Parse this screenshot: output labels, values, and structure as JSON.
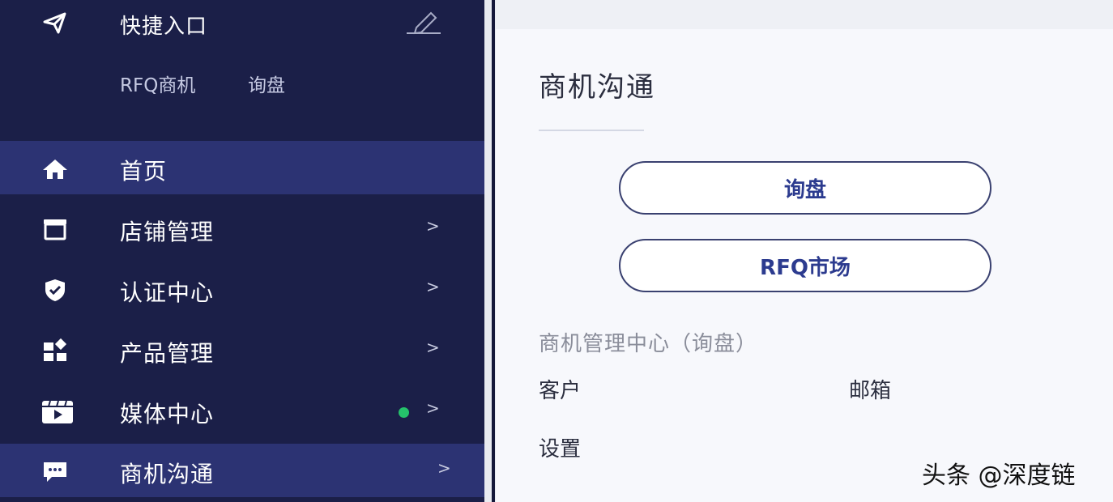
{
  "quick_access": {
    "title": "快捷入口",
    "links": [
      "RFQ商机",
      "询盘"
    ]
  },
  "nav": {
    "items": [
      {
        "label": "首页",
        "icon": "home-icon",
        "active": true
      },
      {
        "label": "店铺管理",
        "icon": "store-icon",
        "chevron": ">"
      },
      {
        "label": "认证中心",
        "icon": "shield-icon",
        "chevron": ">"
      },
      {
        "label": "产品管理",
        "icon": "grid-icon",
        "chevron": ">"
      },
      {
        "label": "媒体中心",
        "icon": "video-icon",
        "chevron": ">",
        "dot_color": "#25c26b"
      },
      {
        "label": "商机沟通",
        "icon": "message-icon",
        "chevron": ">",
        "active": true
      }
    ]
  },
  "panel": {
    "title": "商机沟通",
    "buttons": [
      "询盘",
      "RFQ市场"
    ],
    "section_title": "商机管理中心（询盘）",
    "links": {
      "customer": "客户",
      "mailbox": "邮箱",
      "settings": "设置"
    }
  },
  "watermark": "头条 @深度链",
  "colors": {
    "sidebar_bg": "#1b1f48",
    "active_bg": "#2c3373",
    "accent": "#2c3b8f",
    "dot": "#25c26b"
  }
}
